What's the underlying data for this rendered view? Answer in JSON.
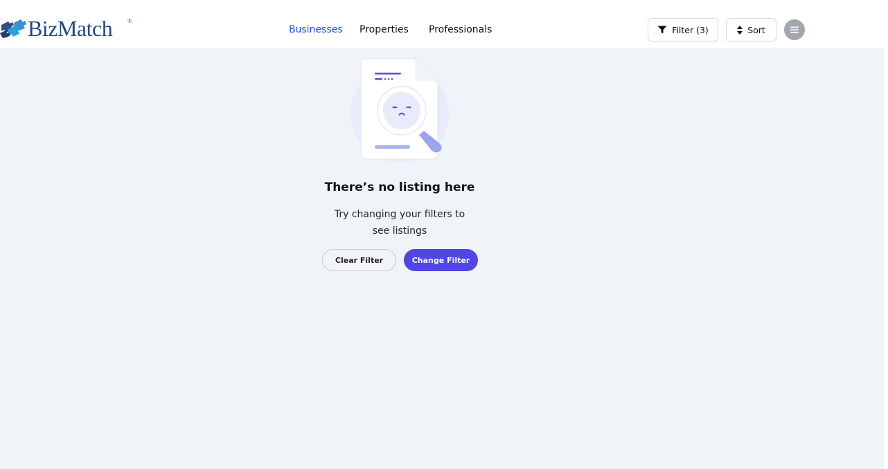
{
  "header": {
    "logo_text": "BizMatch",
    "logo_reg": "®",
    "nav": {
      "businesses": "Businesses",
      "properties": "Properties",
      "professionals": "Professionals"
    },
    "filter_label": "Filter (3)",
    "sort_label": "Sort",
    "icons": {
      "logo": "puzzle-pieces-icon",
      "filter": "funnel-icon",
      "sort": "sort-arrows-icon",
      "menu": "hamburger-menu-icon"
    }
  },
  "empty_state": {
    "illustration": "document-magnifier-sad-icon",
    "title": "There’s no listing here",
    "message_line1": "Try changing your filters to",
    "message_line2": "see listings",
    "clear_button": "Clear Filter",
    "change_button": "Change Filter"
  },
  "colors": {
    "accent": "#4f46e5",
    "active_nav": "#1d4ed8",
    "logo_blue": "#1f4a85",
    "background": "#f0f3f8"
  }
}
